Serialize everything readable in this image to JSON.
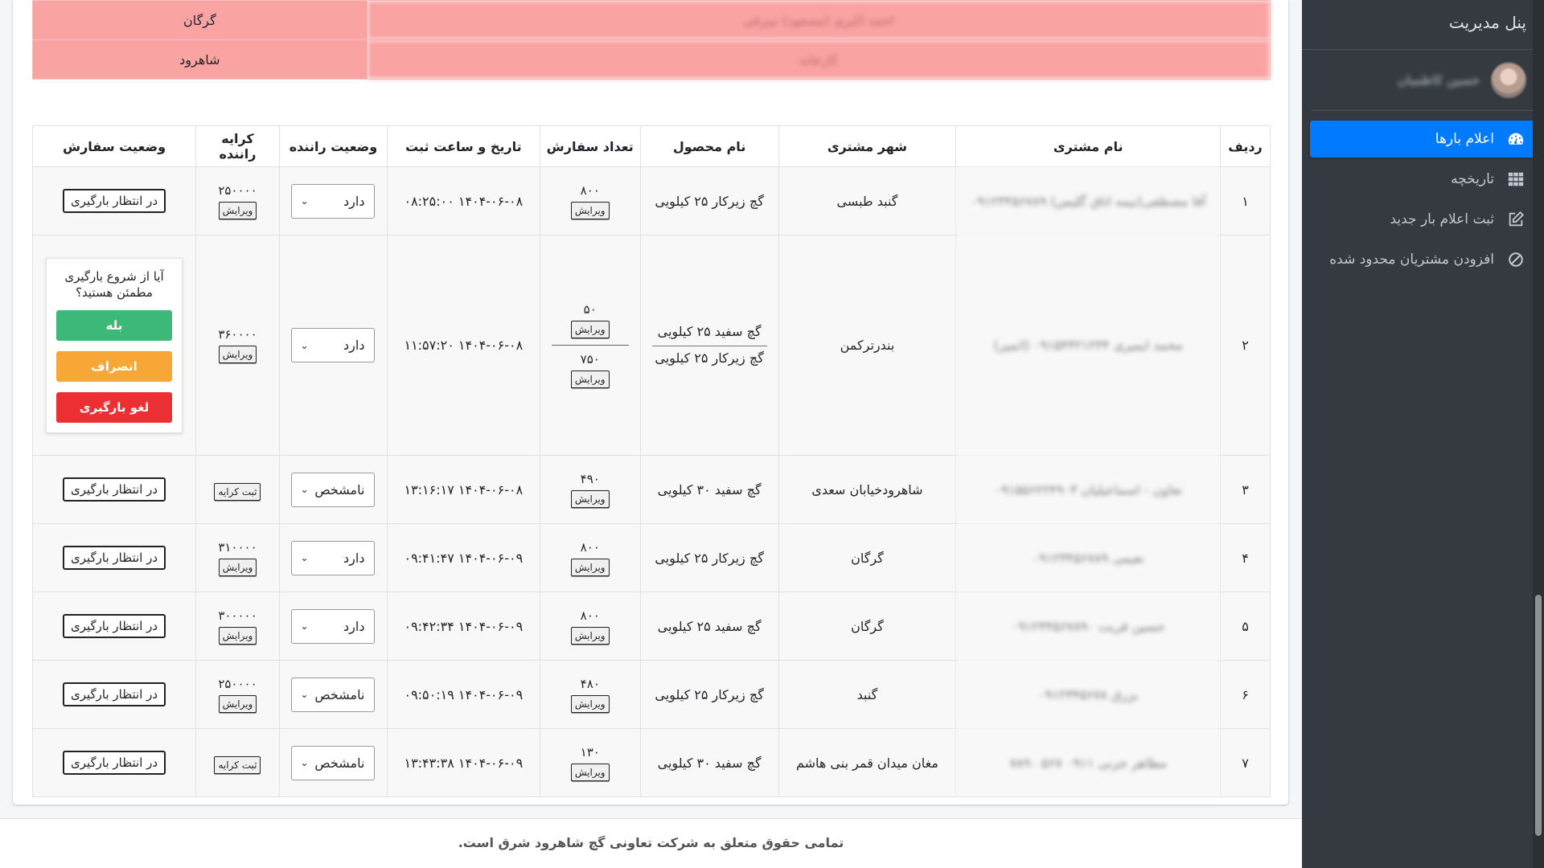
{
  "sidebar": {
    "brand": "پنل مدیریت",
    "user_name": "حسین کاظمیان",
    "items": [
      {
        "label": "اعلام بارها",
        "icon": "dashboard-gauge-icon",
        "active": true
      },
      {
        "label": "تاریخچه",
        "icon": "grid-icon",
        "active": false
      },
      {
        "label": "ثبت اعلام بار جدید",
        "icon": "edit-icon",
        "active": false
      },
      {
        "label": "افزودن مشتریان محدود شده",
        "icon": "ban-icon",
        "active": false
      }
    ]
  },
  "top_table": [
    {
      "name": "احمد اکبری (مسعود) نیبرقی",
      "city": "گرگان"
    },
    {
      "name": "کارخانه",
      "city": "شاهرود"
    }
  ],
  "orders": {
    "headers": [
      "ردیف",
      "نام مشتری",
      "شهر مشتری",
      "نام محصول",
      "تعداد سفارش",
      "تاریخ و ساعت ثبت",
      "وضعیت راننده",
      "کرایه راننده",
      "وضعیت سفارش"
    ],
    "edit_label": "ویرایش",
    "set_fare_label": "ثبت کرایه",
    "wait_label": "در انتظار بارگیری",
    "rows": [
      {
        "idx": "۱",
        "customer": "آقا مصطفی(تیمه اتاق گلیس) ۰۹۱۲۳۴۵۶۷۸۹",
        "city": "گنبد طبسی",
        "product": "گچ زیرکار ۲۵ کیلویی",
        "qty": "۸۰۰",
        "date": "۱۴۰۴-۰۶-۰۸ ۰۸:۲۵:۰۰",
        "driver_status": "دارد",
        "fare": "۲۵۰۰۰۰"
      },
      {
        "idx": "۲",
        "customer": "محمد ایمیری ۰۹۱۵۴۳۲۱۲۳۴ (اتمپر)",
        "city": "بندرترکمن",
        "product_a": "گچ سفید ۲۵ کیلویی",
        "product_b": "گچ زیرکار ۲۵ کیلویی",
        "qty_a": "۵۰",
        "qty_b": "۷۵۰",
        "date": "۱۴۰۴-۰۶-۰۸ ۱۱:۵۷:۲۰",
        "driver_status": "دارد",
        "fare": "۳۶۰۰۰۰"
      },
      {
        "idx": "۳",
        "customer": "تعاون - اسماعیلیان ۰۹۱۵۵۶۲۲۴۹۰۳",
        "city": "شاهرودخیابان سعدی",
        "product": "گچ سفید ۳۰ کیلویی",
        "qty": "۴۹۰",
        "date": "۱۴۰۴-۰۶-۰۸ ۱۳:۱۶:۱۷",
        "driver_status": "نامشخص"
      },
      {
        "idx": "۴",
        "customer": "نعیمی ۰۹۱۲۳۴۵۶۷۸۹",
        "city": "گرگان",
        "product": "گچ زیرکار ۲۵ کیلویی",
        "qty": "۸۰۰",
        "date": "۱۴۰۴-۰۶-۰۹ ۰۹:۴۱:۴۷",
        "driver_status": "دارد",
        "fare": "۳۱۰۰۰۰"
      },
      {
        "idx": "۵",
        "customer": "حسین قربت ۰۹۱۲۳۴۵۶۷۸۹۰",
        "city": "گرگان",
        "product": "گچ سفید ۲۵ کیلویی",
        "qty": "۸۰۰",
        "date": "۱۴۰۴-۰۶-۰۹ ۰۹:۴۲:۳۴",
        "driver_status": "دارد",
        "fare": "۳۰۰۰۰۰"
      },
      {
        "idx": "۶",
        "customer": "بزرق ۰۹۱۲۳۴۵۶۷۸",
        "city": "گنبد",
        "product": "گچ زیرکار ۲۵ کیلویی",
        "qty": "۴۸۰",
        "date": "۱۴۰۴-۰۶-۰۹ ۰۹:۵۰:۱۹",
        "driver_status": "نامشخص",
        "fare": "۲۵۰۰۰۰"
      },
      {
        "idx": "۷",
        "customer": "مظاهر جزنی ۰۹۱۱ ۵۶۷ ۷۸۹۰",
        "city": "مغان میدان قمر بنی هاشم",
        "product": "گچ سفید ۳۰ کیلویی",
        "qty": "۱۳۰",
        "date": "۱۴۰۴-۰۶-۰۹ ۱۳:۴۳:۳۸",
        "driver_status": "نامشخص"
      }
    ]
  },
  "confirm": {
    "question": "آیا از شروع بارگیری مطمئن هستید؟",
    "yes": "بله",
    "cancel": "انصراف",
    "abort": "لغو بارگیری"
  },
  "footer": "تمامی حقوق متعلق به شرکت تعاونی گچ شاهرود شرق است.",
  "colors": {
    "sidebar_bg": "#343a40",
    "active_nav": "#007bff",
    "top_row_bg": "#f9a3a3",
    "yes": "#3cb878",
    "cancel": "#f6a735",
    "abort": "#ec2f33"
  }
}
